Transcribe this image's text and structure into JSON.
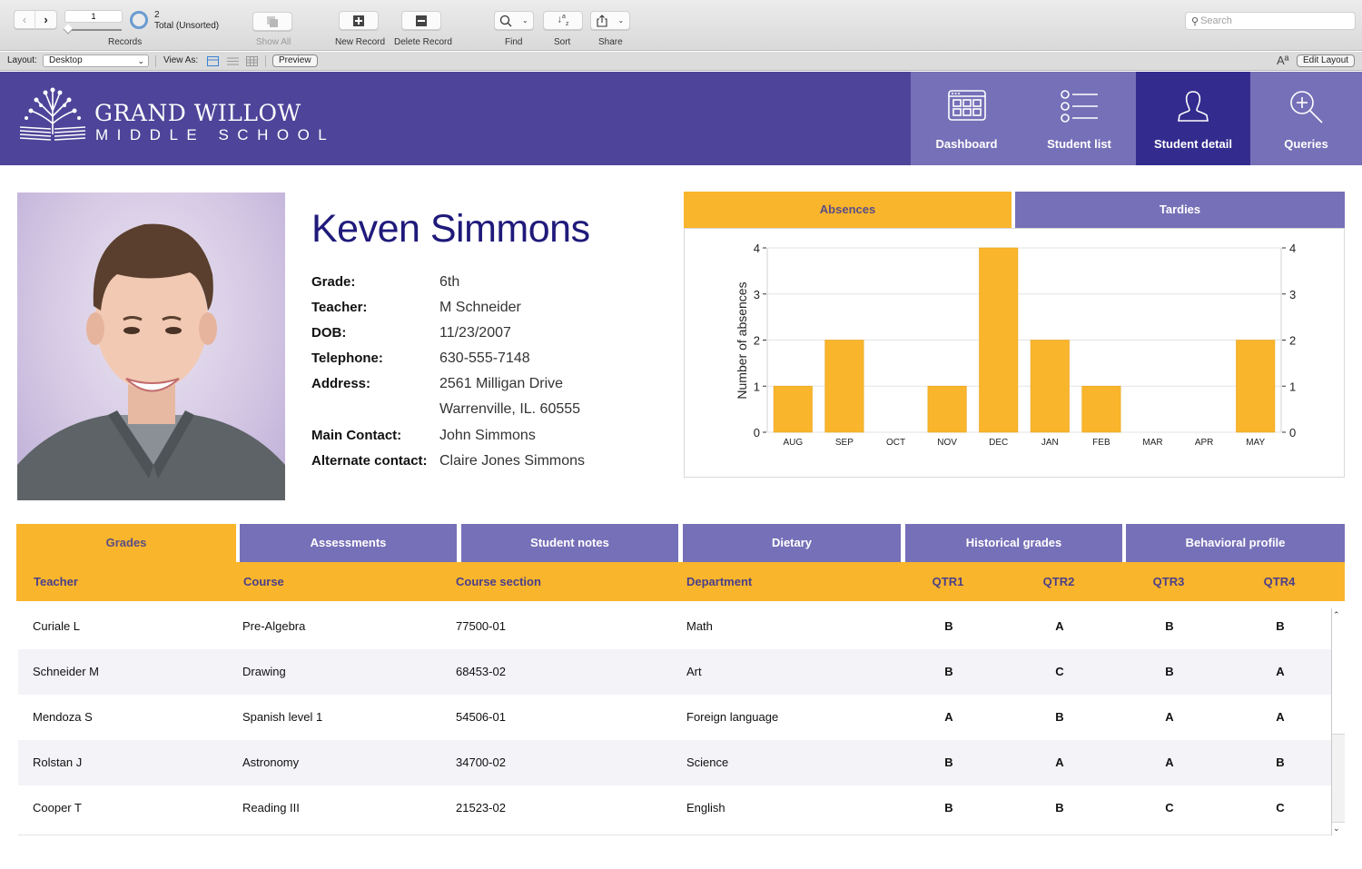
{
  "toolbar": {
    "record_number": "1",
    "record_total": "2",
    "record_total_label": "Total (Unsorted)",
    "records_label": "Records",
    "show_all_label": "Show All",
    "new_record_label": "New Record",
    "delete_record_label": "Delete Record",
    "find_label": "Find",
    "sort_label": "Sort",
    "share_label": "Share",
    "search_placeholder": "Search"
  },
  "layoutbar": {
    "layout_label": "Layout:",
    "layout_value": "Desktop",
    "view_as_label": "View As:",
    "preview_label": "Preview",
    "edit_layout_label": "Edit Layout",
    "font_size_glyph": "Aª"
  },
  "header": {
    "school_name": "GRAND WILLOW",
    "school_sub": "MIDDLE SCHOOL",
    "nav": [
      {
        "label": "Dashboard",
        "icon": "dashboard-icon",
        "active": false
      },
      {
        "label": "Student list",
        "icon": "list-icon",
        "active": false
      },
      {
        "label": "Student detail",
        "icon": "user-icon",
        "active": true
      },
      {
        "label": "Queries",
        "icon": "zoom-in-icon",
        "active": false
      }
    ]
  },
  "student": {
    "name": "Keven Simmons",
    "fields": [
      {
        "label": "Grade:",
        "value": "6th"
      },
      {
        "label": "Teacher:",
        "value": "M Schneider"
      },
      {
        "label": "DOB:",
        "value": "11/23/2007"
      },
      {
        "label": "Telephone:",
        "value": "630-555-7148"
      },
      {
        "label": "Address:",
        "value": "2561 Milligan Drive"
      },
      {
        "label": "",
        "value": "Warrenville, IL. 60555"
      },
      {
        "label": "Main Contact:",
        "value": "John Simmons"
      },
      {
        "label": "Alternate contact:",
        "value": "Claire Jones Simmons"
      }
    ]
  },
  "chart_tabs": [
    {
      "label": "Absences",
      "active": true
    },
    {
      "label": "Tardies",
      "active": false
    }
  ],
  "chart_data": {
    "type": "bar",
    "title": "",
    "xlabel": "",
    "ylabel": "Number of absences",
    "categories": [
      "AUG",
      "SEP",
      "OCT",
      "NOV",
      "DEC",
      "JAN",
      "FEB",
      "MAR",
      "APR",
      "MAY"
    ],
    "values": [
      1,
      2,
      0,
      1,
      4,
      2,
      1,
      0,
      0,
      2
    ],
    "ylim": [
      0,
      4
    ],
    "yticks": [
      0,
      1,
      2,
      3,
      4
    ],
    "grid": true,
    "secondary_y_axis": true,
    "bar_color": "#f9b52c"
  },
  "grades": {
    "tabs": [
      {
        "label": "Grades",
        "active": true
      },
      {
        "label": "Assessments",
        "active": false
      },
      {
        "label": "Student notes",
        "active": false
      },
      {
        "label": "Dietary",
        "active": false
      },
      {
        "label": "Historical grades",
        "active": false
      },
      {
        "label": "Behavioral profile",
        "active": false
      }
    ],
    "columns": [
      "Teacher",
      "Course",
      "Course section",
      "Department",
      "QTR1",
      "QTR2",
      "QTR3",
      "QTR4"
    ],
    "rows": [
      [
        "Curiale L",
        "Pre-Algebra",
        "77500-01",
        "Math",
        "B",
        "A",
        "B",
        "B"
      ],
      [
        "Schneider M",
        "Drawing",
        "68453-02",
        "Art",
        "B",
        "C",
        "B",
        "A"
      ],
      [
        "Mendoza S",
        "Spanish level 1",
        "54506-01",
        "Foreign language",
        "A",
        "B",
        "A",
        "A"
      ],
      [
        "Rolstan J",
        "Astronomy",
        "34700-02",
        "Science",
        "B",
        "A",
        "A",
        "B"
      ],
      [
        "Cooper T",
        "Reading III",
        "21523-02",
        "English",
        "B",
        "B",
        "C",
        "C"
      ]
    ]
  },
  "colors": {
    "header_bg": "#4e4499",
    "nav_tab": "#7670b8",
    "nav_tab_active": "#332c8e",
    "accent_orange": "#f9b52c",
    "name_color": "#1f1a7a"
  }
}
